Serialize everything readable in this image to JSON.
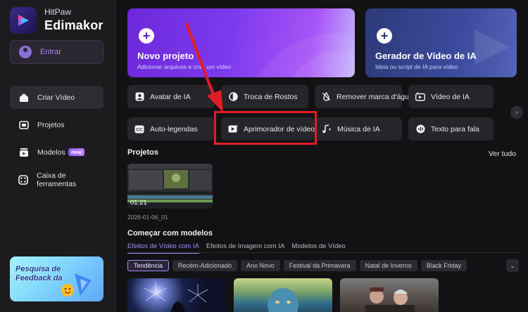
{
  "app": {
    "brand_top": "HitPaw",
    "brand_main": "Edimakor",
    "accent": "#a78bfa"
  },
  "sidebar": {
    "login": "Entrar",
    "items": [
      {
        "label": "Criar Vídeo",
        "icon": "home-icon",
        "active": true
      },
      {
        "label": "Projetos",
        "icon": "folder-icon"
      },
      {
        "label": "Modelos",
        "icon": "templates-icon",
        "badge": "New"
      },
      {
        "label": "Caixa de ferramentas",
        "icon": "toolbox-icon"
      }
    ],
    "feedback": "Pesquisa de Feedback da"
  },
  "hero": [
    {
      "title": "Novo projeto",
      "subtitle": "Adicionar arquivos e criar um vídeo"
    },
    {
      "title": "Gerador de Vídeo de IA",
      "subtitle": "Ideia ou script de IA para vídeo"
    }
  ],
  "tools": [
    {
      "label": "Avatar de IA",
      "icon": "avatar-icon"
    },
    {
      "label": "Troca de Rostos",
      "icon": "face-swap-icon"
    },
    {
      "label": "Remover marca d'água",
      "icon": "watermark-remove-icon"
    },
    {
      "label": "Vídeo de IA",
      "icon": "ai-video-icon"
    },
    {
      "label": "Auto-legendas",
      "icon": "captions-icon"
    },
    {
      "label": "Aprimorador de vídeo",
      "icon": "video-enhancer-icon"
    },
    {
      "label": "Música de IA",
      "icon": "music-icon"
    },
    {
      "label": "Texto para fala",
      "icon": "tts-icon"
    }
  ],
  "projects": {
    "title": "Projetos",
    "see_all": "Ver tudo",
    "items": [
      {
        "duration": "01:21",
        "name": "2026-01-06_01"
      }
    ]
  },
  "templates": {
    "title": "Começar com modelos",
    "tabs": [
      "Efeitos de Vídeo com IA",
      "Efeitos de Imagem com IA",
      "Modelos de Vídeo"
    ],
    "active_tab": 0,
    "filters": [
      "Tendência",
      "Recém-Adicionado",
      "Ano Novo",
      "Festival da Primavera",
      "Natal de Inverno",
      "Black Friday"
    ],
    "active_filter": 0
  }
}
